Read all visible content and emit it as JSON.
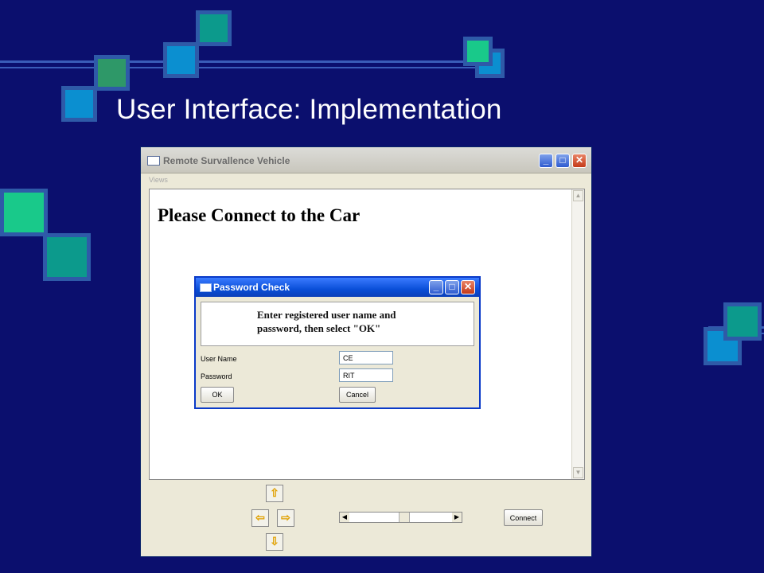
{
  "slide": {
    "title": "User Interface: Implementation"
  },
  "window": {
    "title": "Remote Survallence Vehicle",
    "menu": [
      "Views"
    ],
    "heading": "Please Connect to the Car",
    "connect_label": "Connect",
    "arrows": {
      "up": "⇧",
      "left": "⇦",
      "right": "⇨",
      "down": "⇩"
    },
    "scrollbar": {
      "left": "◀",
      "right": "▶",
      "up": "▲",
      "down": "▼"
    }
  },
  "dialog": {
    "title": "Password Check",
    "message": [
      "Enter registered user name and",
      "password, then select \"OK\""
    ],
    "username_label": "User Name",
    "username_value": "CE",
    "password_label": "Password",
    "password_value": "RIT",
    "ok_label": "OK",
    "cancel_label": "Cancel"
  },
  "titlebar_buttons": {
    "minimize": "_",
    "maximize": "□",
    "close": "✕"
  },
  "colors": {
    "background": "#0b0f6e",
    "square_blue": "#0b8fd0",
    "square_teal": "#0c9a8c",
    "square_green": "#19c98a",
    "square_olive": "#2e9868",
    "dialog_title": "#0a4fd8"
  }
}
